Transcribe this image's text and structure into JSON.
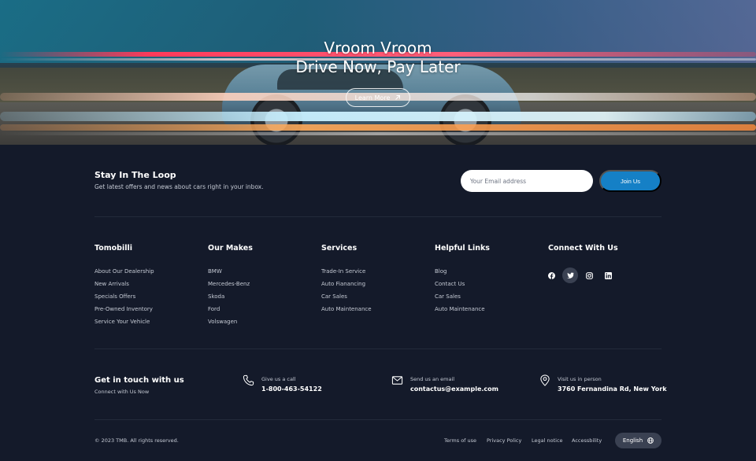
{
  "hero": {
    "title_line1": "Vroom Vroom",
    "title_line2": "Drive Now, Pay Later",
    "cta_label": "Learn More"
  },
  "newsletter": {
    "title": "Stay In The Loop",
    "subtitle": "Get latest offers and news about cars right in your inbox.",
    "email_placeholder": "Your Email address",
    "email_value": "",
    "button_label": "Join Us"
  },
  "columns": [
    {
      "title": "Tomobilli",
      "items": [
        "About Our Dealership",
        "New Arrivals",
        "Specials Offers",
        "Pre-Owned Inventory",
        "Service Your Vehicle"
      ]
    },
    {
      "title": "Our Makes",
      "items": [
        "BMW",
        "Mercedes-Benz",
        "Skoda",
        "Ford",
        "Volswagen"
      ]
    },
    {
      "title": "Services",
      "items": [
        "Trade-In Service",
        "Auto Fianancing",
        "Car Sales",
        "Auto Maintenance"
      ]
    },
    {
      "title": "Helpful Links",
      "items": [
        "Blog",
        "Contact Us",
        "Car Sales",
        "Auto Maintenance"
      ]
    },
    {
      "title": "Connect With Us",
      "social_icons": [
        "facebook-icon",
        "twitter-icon",
        "instagram-icon",
        "linkedin-icon"
      ],
      "active_social": "twitter-icon"
    }
  ],
  "contact": {
    "title": "Get in touch with us",
    "subtitle": "Connect with Us Now",
    "phone": {
      "label": "Give us a call",
      "value": "1-800-463-54122",
      "icon": "phone-icon"
    },
    "email": {
      "label": "Send us an email",
      "value": "contactus@example.com",
      "icon": "mail-icon"
    },
    "address": {
      "label": "Visit us in person",
      "value": "3760 Fernandina Rd, New York",
      "icon": "map-pin-icon"
    }
  },
  "footer": {
    "copyright": "© 2023 TMB. All rights reserved.",
    "links": [
      "Terms of use",
      "Privacy Policy",
      "Legal notice",
      "Accessbility"
    ],
    "language": "English"
  },
  "colors": {
    "background": "#141a2a",
    "accent": "#1580c6",
    "pill": "#3a4152"
  }
}
